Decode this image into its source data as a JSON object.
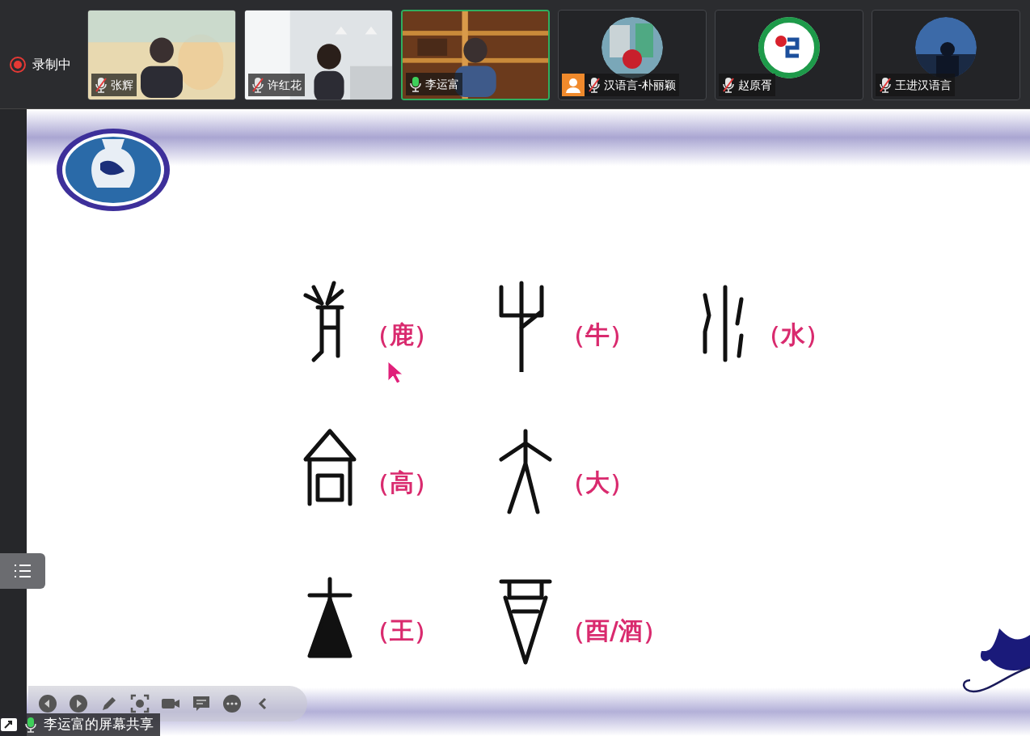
{
  "recording": {
    "label": "录制中",
    "on": true
  },
  "participants": [
    {
      "name": "张辉",
      "muted": true,
      "speaking": false,
      "kind": "video"
    },
    {
      "name": "许红花",
      "muted": true,
      "speaking": false,
      "kind": "video"
    },
    {
      "name": "李运富",
      "muted": false,
      "speaking": true,
      "kind": "video"
    },
    {
      "name": "汉语言-朴丽颖",
      "muted": true,
      "speaking": false,
      "kind": "avatar",
      "badge": true
    },
    {
      "name": "赵原胥",
      "muted": true,
      "speaking": false,
      "kind": "avatar"
    },
    {
      "name": "王进汉语言",
      "muted": true,
      "speaking": false,
      "kind": "avatar"
    }
  ],
  "slide": {
    "rows": [
      [
        {
          "label": "（鹿）"
        },
        {
          "label": "（牛）"
        },
        {
          "label": "（水）"
        }
      ],
      [
        {
          "label": "（高）"
        },
        {
          "label": "（大）"
        }
      ],
      [
        {
          "label": "（王）"
        },
        {
          "label": "（酉/酒）"
        }
      ]
    ]
  },
  "share_label": {
    "text": "李运富的屏幕共享",
    "muted": false
  }
}
